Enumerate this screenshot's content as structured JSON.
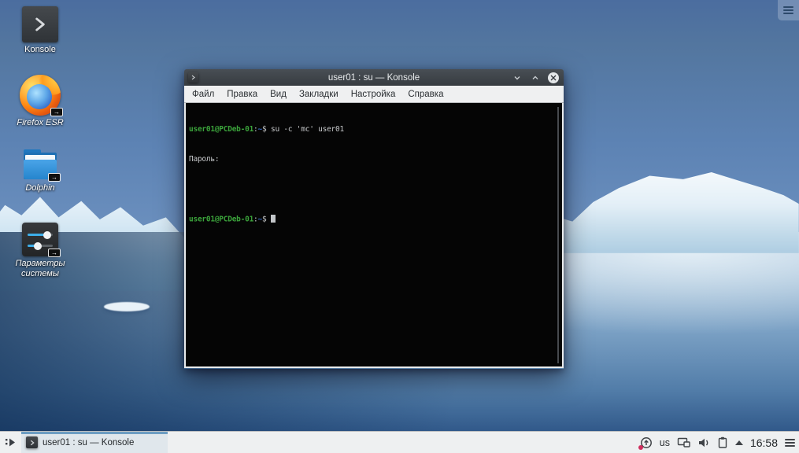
{
  "desktop": {
    "icons": [
      {
        "label": "Konsole"
      },
      {
        "label": "Firefox ESR"
      },
      {
        "label": "Dolphin"
      },
      {
        "label": "Параметры системы"
      }
    ]
  },
  "window": {
    "title": "user01 : su — Konsole",
    "menu": [
      "Файл",
      "Правка",
      "Вид",
      "Закладки",
      "Настройка",
      "Справка"
    ],
    "terminal": {
      "prompt_user": "user01@PCDeb-01",
      "prompt_colon": ":",
      "prompt_path": "~",
      "prompt_dollar": "$ ",
      "command": "su -c 'mc' user01",
      "password_prompt": "Пароль:"
    }
  },
  "panel": {
    "task_label": "user01 : su — Konsole",
    "tray": {
      "keyboard_layout": "us",
      "clock": "16:58"
    }
  },
  "colors": {
    "terminal_green": "#3ba33b",
    "terminal_blue": "#3769bd",
    "terminal_fg": "#c7c9cb",
    "terminal_bg": "#050505",
    "titlebar_bg": "#3c4247",
    "menubar_bg": "#eff0f1",
    "panel_bg": "#eef0f1",
    "task_indicator": "#6d9dc2",
    "wallpaper_sky": "#5d83b4",
    "wallpaper_water_dark": "#27517f"
  }
}
